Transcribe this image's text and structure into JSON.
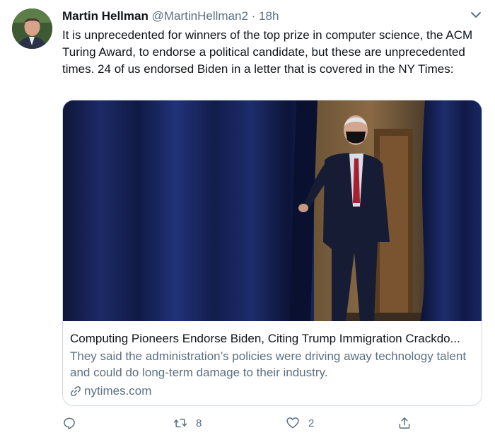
{
  "tweet": {
    "author_name": "Martin Hellman",
    "author_handle": "@MartinHellman2",
    "separator": "·",
    "time": "18h",
    "text": "It is unprecedented for winners of the top prize in computer science, the ACM Turing Award, to endorse a political candidate, but these are unprecedented times. 24 of us endorsed Biden in a letter that is covered in the NY Times:"
  },
  "card": {
    "title": "Computing Pioneers Endorse Biden, Citing Trump Immigration Crackdo...",
    "description": "They said the administration’s policies were driving away technology talent and could do long-term damage to their industry.",
    "domain": "nytimes.com"
  },
  "actions": {
    "reply_icon": "reply-icon",
    "retweet_count": "8",
    "like_count": "2",
    "share_icon": "share-icon"
  },
  "colors": {
    "text": "#0f1419",
    "muted": "#5b7083",
    "border": "#cfd9de",
    "curtain": "#141e45"
  }
}
